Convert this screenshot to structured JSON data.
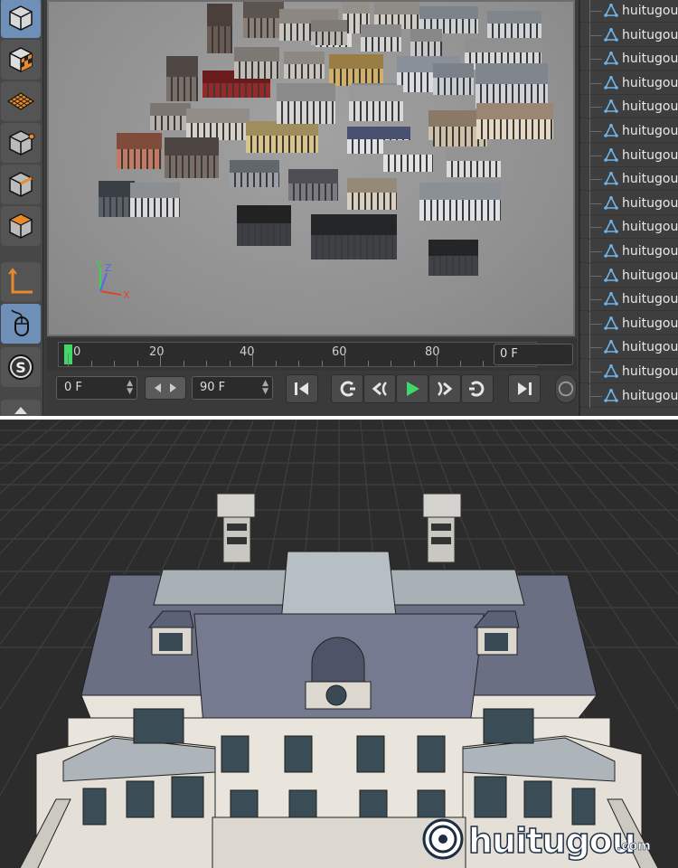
{
  "timeline": {
    "ticks": [
      "0",
      "20",
      "40",
      "60",
      "80"
    ],
    "current_frame": "0 F"
  },
  "transport": {
    "start_field": "0 F",
    "end_field": "90 F"
  },
  "object_manager": {
    "items": [
      "huitugou",
      "huitugou",
      "huitugou",
      "huitugou",
      "huitugou",
      "huitugou",
      "huitugou",
      "huitugou",
      "huitugou",
      "huitugou",
      "huitugou",
      "huitugou",
      "huitugou",
      "huitugou",
      "huitugou",
      "huitugou",
      "huitugou"
    ]
  },
  "viewport": {
    "axis_labels": {
      "x": "X",
      "y": "Y",
      "z": "Z"
    }
  },
  "watermark": {
    "brand": "huitugou",
    "domain": ".com"
  },
  "colors": {
    "accent": "#6d8fb8",
    "playhead": "#3fd96a",
    "axis_x": "#e0452b",
    "axis_y": "#3ad34f",
    "axis_z": "#4a6fe8"
  }
}
